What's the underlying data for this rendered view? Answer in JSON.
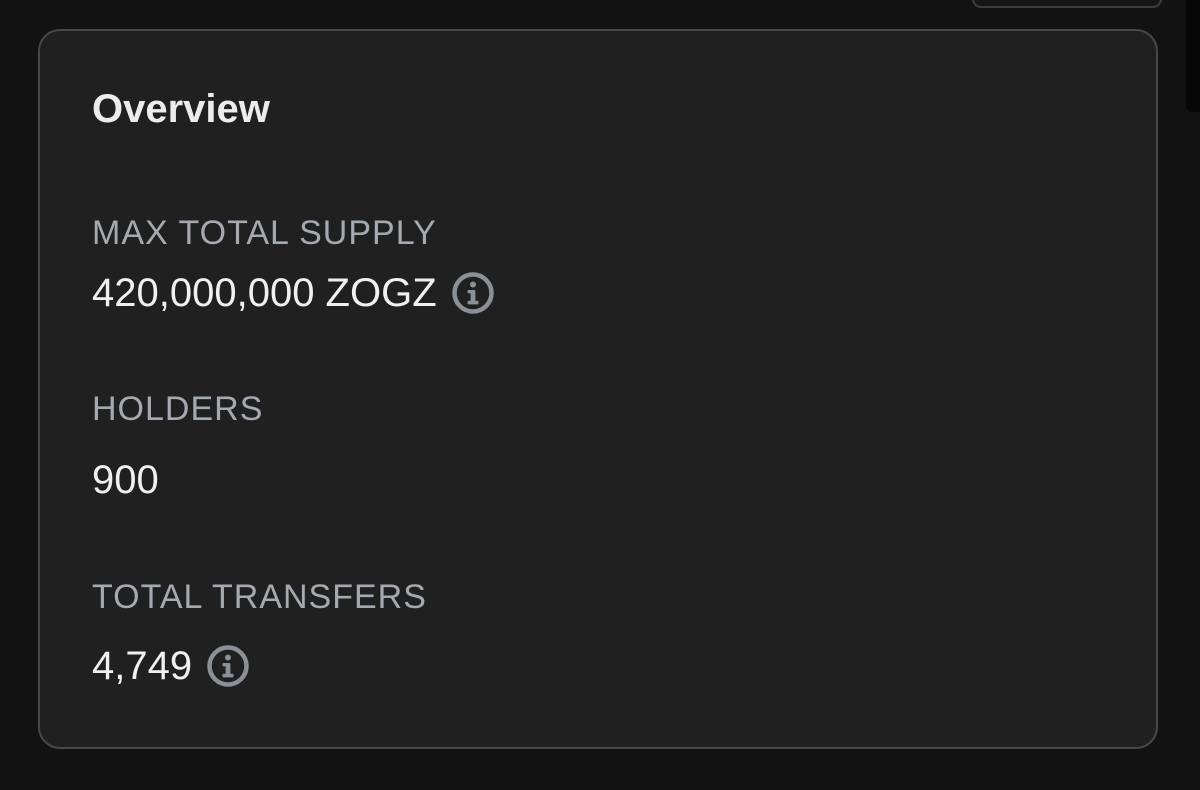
{
  "overview": {
    "title": "Overview",
    "max_total_supply": {
      "label": "MAX TOTAL SUPPLY",
      "value": "420,000,000 ZOGZ",
      "icon": "info-icon"
    },
    "holders": {
      "label": "HOLDERS",
      "value": "900"
    },
    "total_transfers": {
      "label": "TOTAL TRANSFERS",
      "value": "4,749",
      "icon": "info-icon"
    }
  },
  "colors": {
    "background": "#121213",
    "card": "#202021",
    "border": "#48484b",
    "label": "#a5a9b0",
    "value": "#f0f0f2",
    "icon": "#8b8f96"
  }
}
